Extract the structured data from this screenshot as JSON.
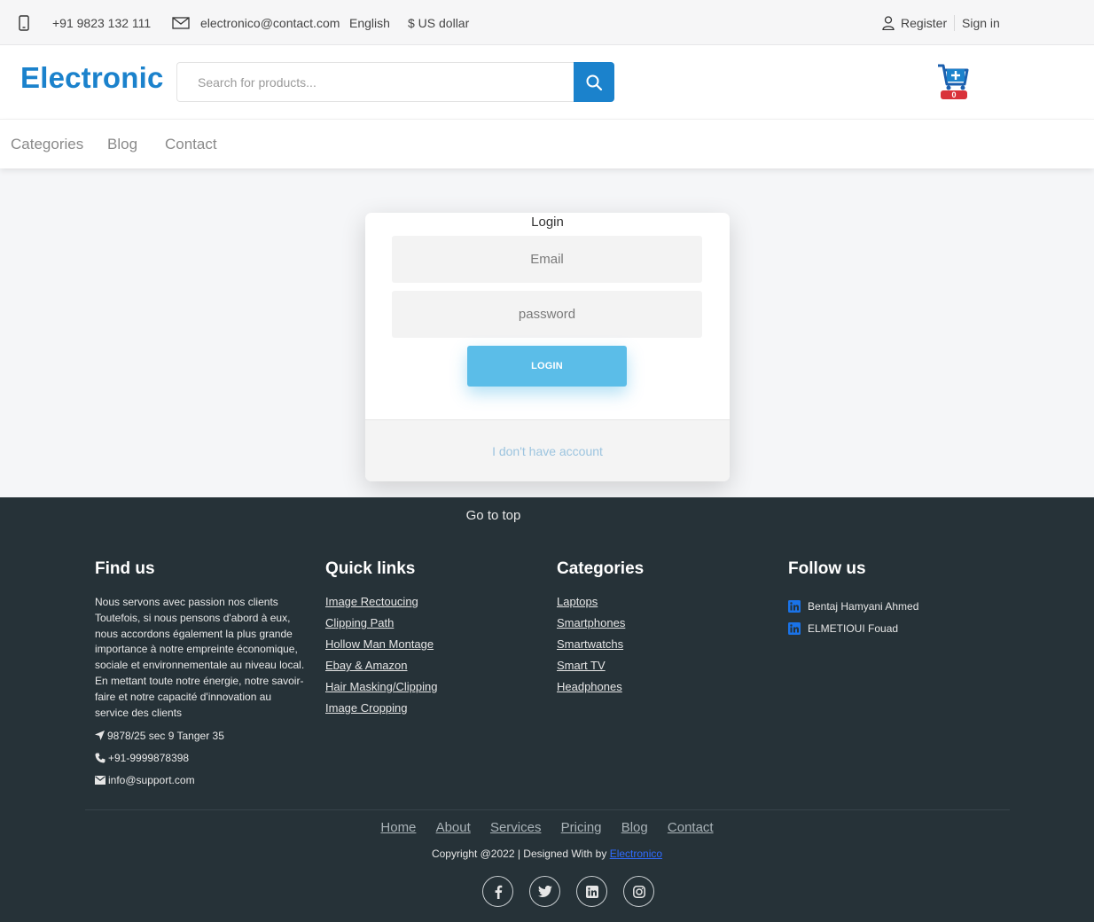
{
  "topbar": {
    "phone": "+91 9823 132 111",
    "email": "electronico@contact.com",
    "language": "English",
    "currency": "$ US dollar",
    "register": "Register",
    "signin": "Sign in"
  },
  "header": {
    "logo": "Electronic",
    "search_placeholder": "Search for products...",
    "cart_count": "0"
  },
  "nav": {
    "items": [
      "Categories",
      "Blog",
      "Contact"
    ]
  },
  "login": {
    "title": "Login",
    "email_placeholder": "Email",
    "password_placeholder": "password",
    "button": "LOGIN",
    "no_account": "I don't have account"
  },
  "footer": {
    "go_top": "Go to top",
    "find_us": {
      "title": "Find us",
      "text": "Nous servons avec passion nos clients Toutefois, si nous pensons d'abord à eux, nous accordons également la plus grande importance à notre empreinte économique, sociale et environnementale au niveau local. En mettant toute notre énergie, notre savoir-faire et notre capacité d'innovation au service des clients",
      "address": "9878/25 sec 9 Tanger 35",
      "phone": "+91-9999878398",
      "email": "info@support.com"
    },
    "quick_links": {
      "title": "Quick links",
      "items": [
        "Image Rectoucing",
        "Clipping Path",
        "Hollow Man Montage",
        "Ebay & Amazon",
        "Hair Masking/Clipping",
        "Image Cropping"
      ]
    },
    "categories": {
      "title": "Categories",
      "items": [
        "Laptops",
        "Smartphones",
        "Smartwatchs",
        "Smart TV",
        "Headphones"
      ]
    },
    "follow_us": {
      "title": "Follow us",
      "items": [
        "Bentaj Hamyani Ahmed",
        "ELMETIOUI Fouad"
      ]
    },
    "bottom_links": [
      "Home",
      "About",
      "Services",
      "Pricing",
      "Blog",
      "Contact"
    ],
    "copyright": "Copyright @2022 | Designed With by",
    "brand_link": "Electronico",
    "socials": [
      "facebook-icon",
      "twitter-icon",
      "linkedin-icon",
      "instagram-icon"
    ]
  },
  "colors": {
    "brand": "#1b82cc",
    "login_button": "#5bbde8",
    "footer_bg": "#263238",
    "cart_badge": "#d9323a"
  }
}
